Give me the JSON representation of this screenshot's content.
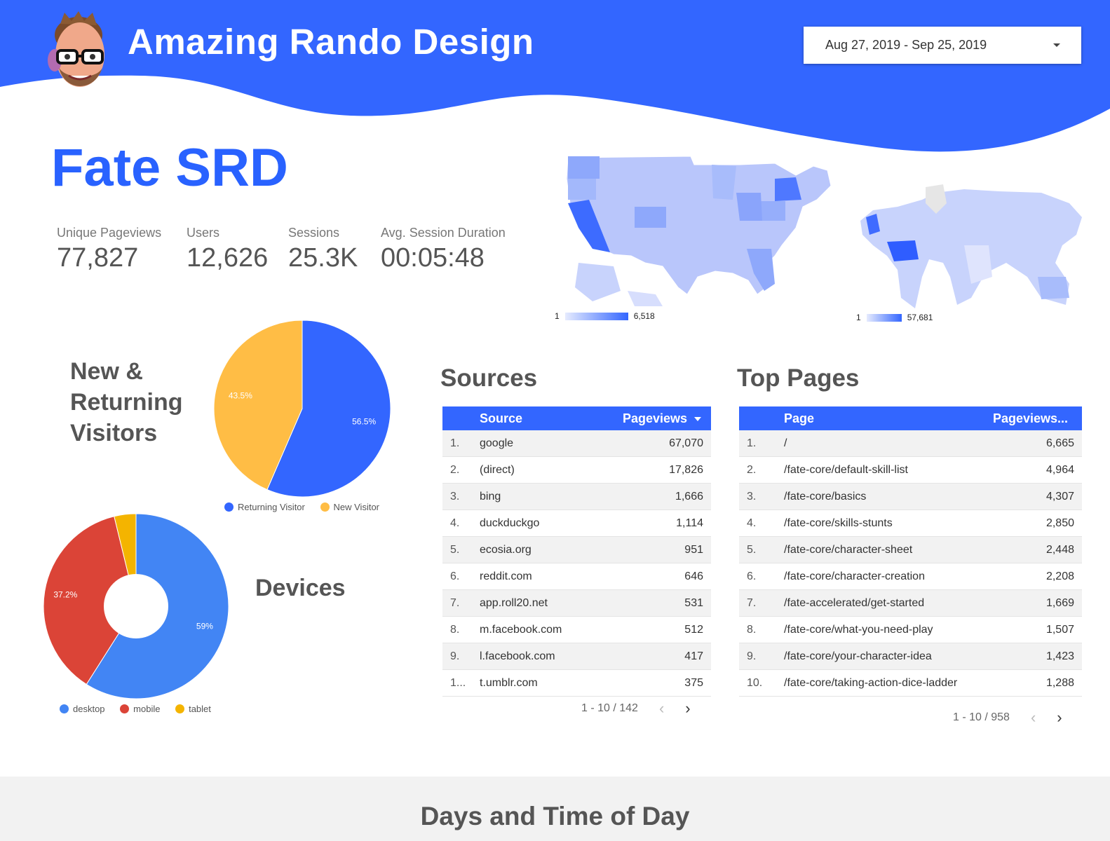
{
  "header": {
    "brand_title": "Amazing Rando Design",
    "date_range": "Aug 27, 2019 - Sep 25, 2019",
    "color": "#3366ff"
  },
  "page_title": "Fate SRD",
  "kpis": [
    {
      "label": "Unique Pageviews",
      "value": "77,827"
    },
    {
      "label": "Users",
      "value": "12,626"
    },
    {
      "label": "Sessions",
      "value": "25.3K"
    },
    {
      "label": "Avg. Session Duration",
      "value": "00:05:48"
    }
  ],
  "maps": {
    "us": {
      "scale_min": "1",
      "scale_max": "6,518"
    },
    "world": {
      "scale_min": "1",
      "scale_max": "57,681"
    }
  },
  "visitors": {
    "heading_lines": [
      "New &",
      "Returning",
      "Visitors"
    ],
    "legend": [
      {
        "label": "Returning Visitor",
        "color": "#3366ff"
      },
      {
        "label": "New Visitor",
        "color": "#ffbd45"
      }
    ]
  },
  "devices": {
    "heading": "Devices",
    "legend": [
      {
        "label": "desktop",
        "color": "#4285f4"
      },
      {
        "label": "mobile",
        "color": "#db4437"
      },
      {
        "label": "tablet",
        "color": "#f4b400"
      }
    ]
  },
  "chart_data": [
    {
      "type": "pie",
      "categories": [
        "Returning Visitor",
        "New Visitor"
      ],
      "values": [
        56.5,
        43.5
      ],
      "labels": [
        "56.5%",
        "43.5%"
      ],
      "colors": [
        "#3366ff",
        "#ffbd45"
      ],
      "legend": "bottom"
    },
    {
      "type": "pie",
      "categories": [
        "desktop",
        "mobile",
        "tablet"
      ],
      "values": [
        59,
        37.2,
        3.8
      ],
      "labels": [
        "59%",
        "37.2%",
        ""
      ],
      "colors": [
        "#4285f4",
        "#db4437",
        "#f4b400"
      ],
      "donut": true,
      "legend": "bottom"
    }
  ],
  "sources": {
    "heading": "Sources",
    "col_source": "Source",
    "col_pageviews": "Pageviews",
    "rows": [
      {
        "idx": "1.",
        "name": "google",
        "value": "67,070"
      },
      {
        "idx": "2.",
        "name": "(direct)",
        "value": "17,826"
      },
      {
        "idx": "3.",
        "name": "bing",
        "value": "1,666"
      },
      {
        "idx": "4.",
        "name": "duckduckgo",
        "value": "1,114"
      },
      {
        "idx": "5.",
        "name": "ecosia.org",
        "value": "951"
      },
      {
        "idx": "6.",
        "name": "reddit.com",
        "value": "646"
      },
      {
        "idx": "7.",
        "name": "app.roll20.net",
        "value": "531"
      },
      {
        "idx": "8.",
        "name": "m.facebook.com",
        "value": "512"
      },
      {
        "idx": "9.",
        "name": "l.facebook.com",
        "value": "417"
      },
      {
        "idx": "1...",
        "name": "t.umblr.com",
        "value": "375"
      }
    ],
    "pager": "1 - 10 / 142"
  },
  "top_pages": {
    "heading": "Top Pages",
    "col_page": "Page",
    "col_pageviews": "Pageviews...",
    "rows": [
      {
        "idx": "1.",
        "name": "/",
        "value": "6,665"
      },
      {
        "idx": "2.",
        "name": "/fate-core/default-skill-list",
        "value": "4,964"
      },
      {
        "idx": "3.",
        "name": "/fate-core/basics",
        "value": "4,307"
      },
      {
        "idx": "4.",
        "name": "/fate-core/skills-stunts",
        "value": "2,850"
      },
      {
        "idx": "5.",
        "name": "/fate-core/character-sheet",
        "value": "2,448"
      },
      {
        "idx": "6.",
        "name": "/fate-core/character-creation",
        "value": "2,208"
      },
      {
        "idx": "7.",
        "name": "/fate-accelerated/get-started",
        "value": "1,669"
      },
      {
        "idx": "8.",
        "name": "/fate-core/what-you-need-play",
        "value": "1,507"
      },
      {
        "idx": "9.",
        "name": "/fate-core/your-character-idea",
        "value": "1,423"
      },
      {
        "idx": "10.",
        "name": "/fate-core/taking-action-dice-ladder",
        "value": "1,288"
      }
    ],
    "pager": "1 - 10 / 958"
  },
  "bottom_section": {
    "title": "Days and Time of Day"
  }
}
